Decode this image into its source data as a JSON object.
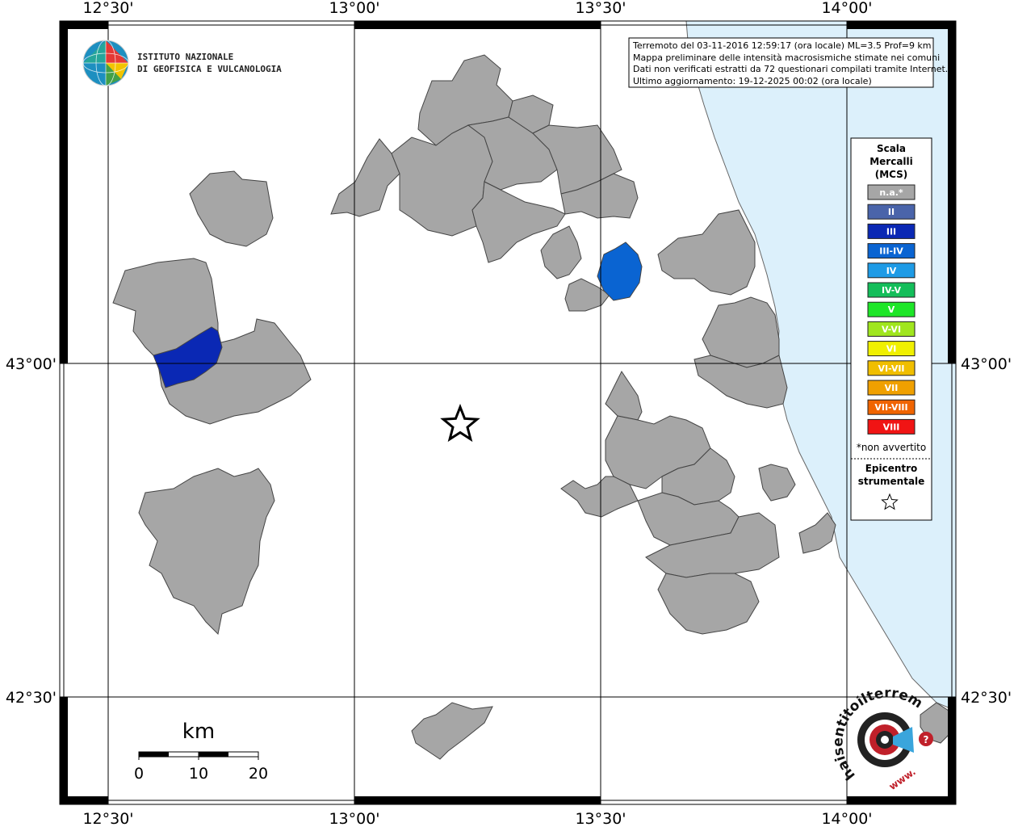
{
  "colors": {
    "sea": "#dcf0fb",
    "municipality_na": "#a6a6a6",
    "municipality_III": "#0a28b4",
    "municipality_III_IV": "#0a64d2",
    "grid": "#000000"
  },
  "logo": {
    "line1": "ISTITUTO NAZIONALE",
    "line2": "DI GEOFISICA E VULCANOLOGIA"
  },
  "info_box": {
    "line1": "Terremoto del 03-11-2016 12:59:17 (ora locale) ML=3.5 Prof=9 km",
    "line2": "Mappa preliminare delle intensità macrosismiche stimate nei comuni",
    "line3": "Dati non verificati estratti da 72 questionari compilati tramite Internet.",
    "line4": "Ultimo aggiornamento: 19-12-2025 00:02 (ora locale)"
  },
  "axes": {
    "lon_labels": [
      "12°30'",
      "13°00'",
      "13°30'",
      "14°00'"
    ],
    "lat_labels": [
      "43°00'",
      "42°30'"
    ]
  },
  "legend": {
    "title1": "Scala",
    "title2": "Mercalli",
    "title3": "(MCS)",
    "classes": [
      {
        "label": "n.a.*",
        "color": "#a6a6a6"
      },
      {
        "label": "II",
        "color": "#4a64aa"
      },
      {
        "label": "III",
        "color": "#0a28b4"
      },
      {
        "label": "III-IV",
        "color": "#0a64d2"
      },
      {
        "label": "IV",
        "color": "#1e9be6"
      },
      {
        "label": "IV-V",
        "color": "#14be5a"
      },
      {
        "label": "V",
        "color": "#1ee628"
      },
      {
        "label": "V-VI",
        "color": "#a0e61e"
      },
      {
        "label": "VI",
        "color": "#f0f000"
      },
      {
        "label": "VI-VII",
        "color": "#f0be00"
      },
      {
        "label": "VII",
        "color": "#f0a000"
      },
      {
        "label": "VII-VIII",
        "color": "#f06400"
      },
      {
        "label": "VIII",
        "color": "#f01414"
      }
    ],
    "note": "*non avvertito",
    "epicenter1": "Epicentro",
    "epicenter2": "strumentale"
  },
  "scale_bar": {
    "unit": "km",
    "ticks": [
      "0",
      "10",
      "20"
    ]
  },
  "watermark": {
    "text": "haisentitoilterremoto.it",
    "www": "www."
  }
}
